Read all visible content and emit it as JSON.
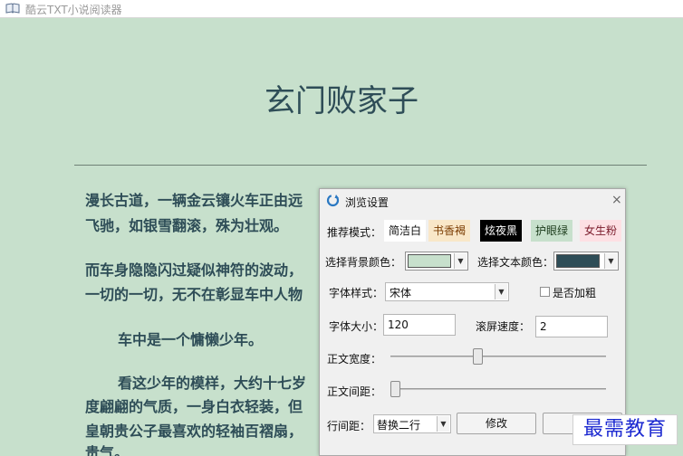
{
  "window": {
    "title": "酷云TXT小说阅读器"
  },
  "reader": {
    "book_title": "玄门败家子",
    "lines": [
      "漫长古道，一辆金云镶火车正由远",
      "飞驰，如银雪翻滚，殊为壮观。",
      "而车身隐隐闪过疑似神符的波动，",
      "一切的一切，无不在彰显车中人物",
      "车中是一个慵懒少年。",
      "看这少年的模样，大约十七岁",
      "度翩翩的气质，一身白衣轻装，但",
      "皇朝贵公子最喜欢的轻袖百褶扇，",
      "贵气。"
    ]
  },
  "dialog": {
    "title": "浏览设置",
    "close_label": "×",
    "preset_label": "推荐模式：",
    "presets": [
      {
        "label": "简洁白",
        "bg": "#ffffff",
        "fg": "#111111"
      },
      {
        "label": "书香褐",
        "bg": "#f9e7c8",
        "fg": "#7a3b00"
      },
      {
        "label": "炫夜黑",
        "bg": "#000000",
        "fg": "#ffffff"
      },
      {
        "label": "护眼绿",
        "bg": "#c7e0cc",
        "fg": "#1a3a1a"
      },
      {
        "label": "女生粉",
        "bg": "#fde0e4",
        "fg": "#7a1b2b"
      }
    ],
    "bg_color_label": "选择背景颜色：",
    "bg_color_value": "#c7e0cc",
    "text_color_label": "选择文本颜色：",
    "text_color_value": "#2e4d57",
    "font_style_label": "字体样式：",
    "font_style_value": "宋体",
    "bold_label": "是否加粗",
    "bold_checked": false,
    "font_size_label": "字体大小：",
    "font_size_value": "120",
    "scroll_speed_label": "滚屏速度：",
    "scroll_speed_value": "2",
    "text_width_label": "正文宽度：",
    "text_width_level": 0.4,
    "text_spacing_label": "正文间距：",
    "text_spacing_level": 0.0,
    "line_spacing_label": "行间距：",
    "line_spacing_value": "替换二行",
    "modify_button": "修改"
  },
  "watermark": {
    "text": "最需教育"
  }
}
